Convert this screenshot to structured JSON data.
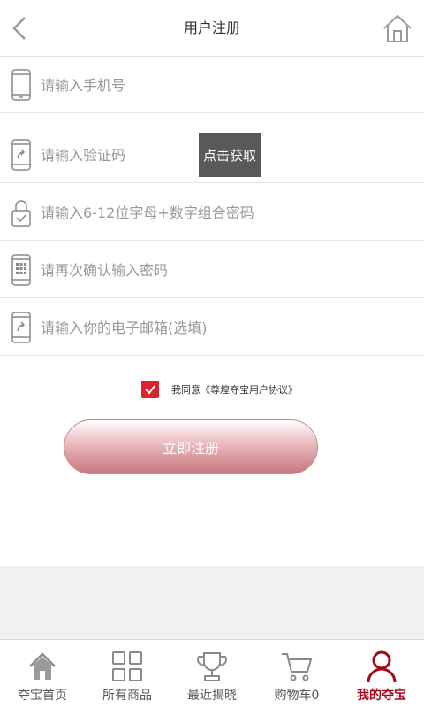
{
  "header": {
    "title": "用户注册",
    "back_icon": "chevron-left-icon",
    "home_icon": "home-icon"
  },
  "form": {
    "phone_placeholder": "请输入手机号",
    "code_placeholder": "请输入验证码",
    "code_button": "点击获取",
    "password_placeholder": "请输入6-12位字母+数字组合密码",
    "confirm_placeholder": "请再次确认输入密码",
    "email_placeholder": "请输入你的电子邮箱(选填)"
  },
  "agreement": {
    "checked": true,
    "text": "我同意《尊煌夺宝用户协议》"
  },
  "submit_label": "立即注册",
  "colors": {
    "accent": "#d9232d",
    "active_tab": "#a8071a",
    "button_dark": "#595959"
  },
  "tabbar": {
    "items": [
      {
        "label": "夺宝首页",
        "icon": "home-icon"
      },
      {
        "label": "所有商品",
        "icon": "grid-icon"
      },
      {
        "label": "最近揭晓",
        "icon": "trophy-icon"
      },
      {
        "label": "购物车0",
        "icon": "cart-icon"
      },
      {
        "label": "我的夺宝",
        "icon": "user-icon",
        "active": true
      }
    ]
  }
}
